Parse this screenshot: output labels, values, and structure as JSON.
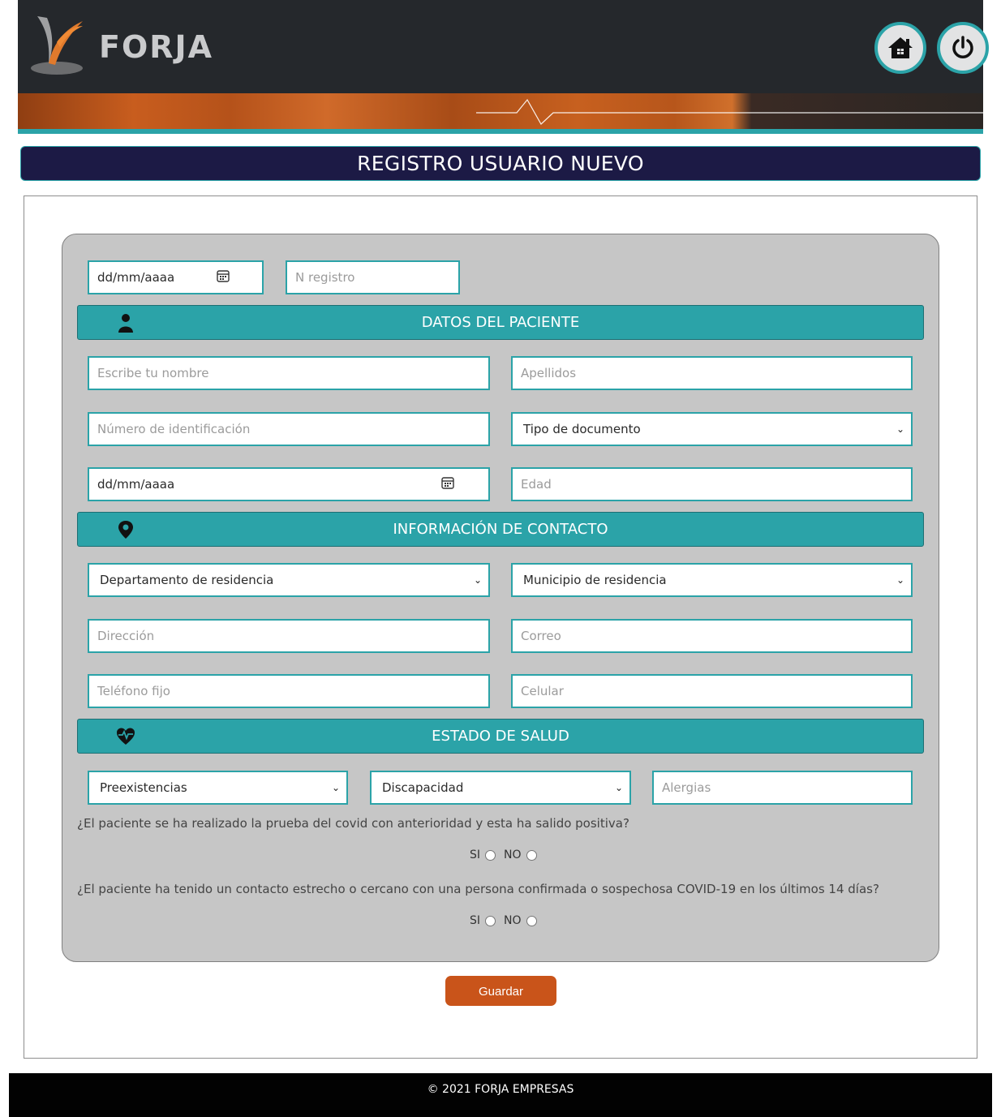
{
  "header": {
    "logo_text": "FORJA",
    "home_icon": "house-icon",
    "power_icon": "power-icon"
  },
  "page_title": "REGISTRO USUARIO NUEVO",
  "top_fields": {
    "date_value": "dd/mm/aaaa",
    "registro_placeholder": "N registro"
  },
  "sections": {
    "paciente": {
      "title": "DATOS DEL PACIENTE",
      "icon": "user-icon"
    },
    "contacto": {
      "title": "INFORMACIÓN DE CONTACTO",
      "icon": "location-pin-icon"
    },
    "salud": {
      "title": "ESTADO DE SALUD",
      "icon": "heart-pulse-icon"
    }
  },
  "paciente": {
    "nombre_placeholder": "Escribe tu nombre",
    "apellidos_placeholder": "Apellidos",
    "identificacion_placeholder": "Número de identificación",
    "tipo_documento": "Tipo de documento",
    "fecha_nacimiento": "dd/mm/aaaa",
    "edad_placeholder": "Edad"
  },
  "contacto": {
    "departamento": "Departamento de residencia",
    "municipio": "Municipio de residencia",
    "direccion_placeholder": "Dirección",
    "correo_placeholder": "Correo",
    "telefono_placeholder": "Teléfono fijo",
    "celular_placeholder": "Celular"
  },
  "salud": {
    "preexistencias": "Preexistencias",
    "discapacidad": "Discapacidad",
    "alergias_placeholder": "Alergias",
    "question_1": "¿El paciente se ha realizado la prueba del covid con anterioridad y esta ha salido positiva?",
    "question_2": "¿El paciente ha tenido un contacto estrecho o cercano con una persona confirmada o sospechosa COVID-19 en los últimos 14 días?",
    "option_si": "SI",
    "option_no": "NO"
  },
  "save_label": "Guardar",
  "footer_text": "© 2021 FORJA EMPRESAS",
  "colors": {
    "header_bg": "#25282c",
    "teal": "#2ba3a8",
    "title_bg": "#1c1a45",
    "panel_bg": "#c6c6c6",
    "save_button": "#c9541a",
    "footer_bg": "#020202"
  }
}
